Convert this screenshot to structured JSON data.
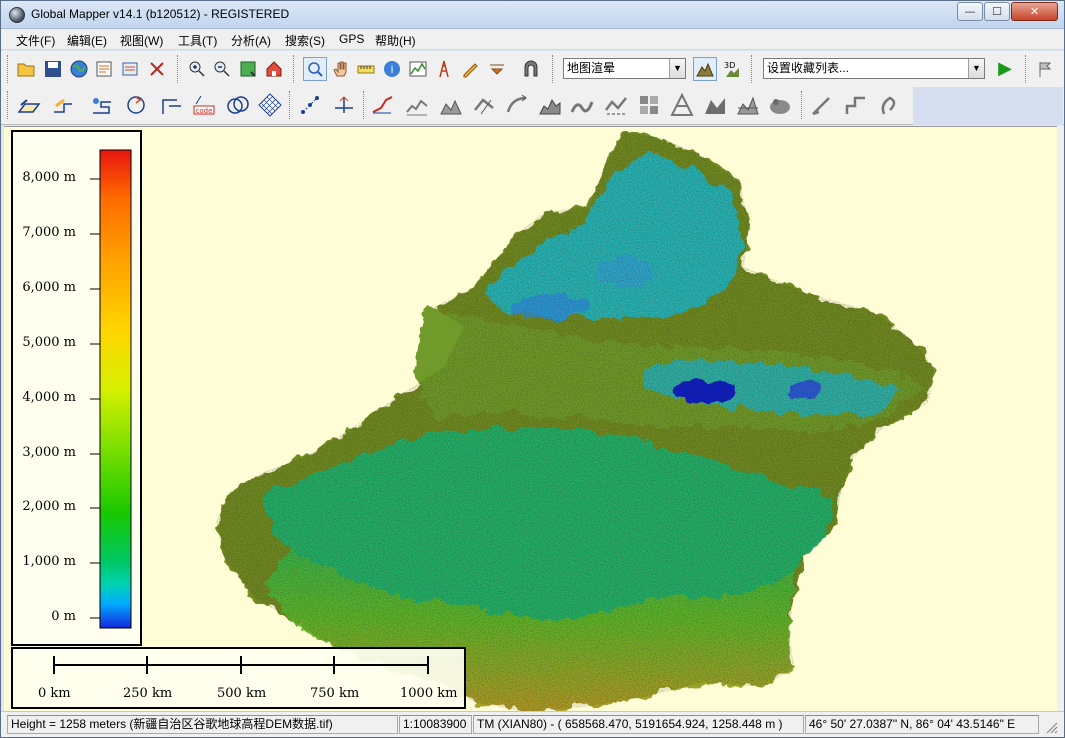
{
  "window": {
    "title": "Global Mapper v14.1 (b120512) - REGISTERED",
    "min_label": "—",
    "max_label": "☐",
    "close_label": "✕"
  },
  "menu": [
    "文件(F)",
    "编辑(E)",
    "视图(W)",
    "工具(T)",
    "分析(A)",
    "搜索(S)",
    "GPS",
    "帮助(H)"
  ],
  "toolbar": {
    "shader_select": "地图渲晕",
    "favorites_select": "设置收藏列表...",
    "run_label": "▶"
  },
  "legend": {
    "labels": [
      "8,000 m",
      "7,000 m",
      "6,000 m",
      "5,000 m",
      "4,000 m",
      "3,000 m",
      "2,000 m",
      "1,000 m",
      "0 m"
    ],
    "gradient_colors": [
      "#e8140e",
      "#ff6a00",
      "#ff9d00",
      "#ffd600",
      "#d6f000",
      "#7ee000",
      "#18c800",
      "#00c864",
      "#00d2b4",
      "#00aaff",
      "#1428dc"
    ]
  },
  "scale": {
    "labels": [
      "0 km",
      "250 km",
      "500 km",
      "750 km",
      "1000 km"
    ]
  },
  "status": {
    "height": "Height = 1258 meters (新疆自治区谷歌地球高程DEM数据.tif)",
    "scale": "1:10083900",
    "projection": "TM (XIAN80) - ( 658568.470, 5191654.924, 1258.448 m )",
    "latlon": "46° 50' 27.0387\" N, 86° 04' 43.5146\" E"
  },
  "colors": {
    "map_background": "#fffdd6",
    "lowland": "#21b06a",
    "basin": "#28b4c8",
    "mountain": "#7a7a14",
    "lake": "#0a1fc8"
  }
}
